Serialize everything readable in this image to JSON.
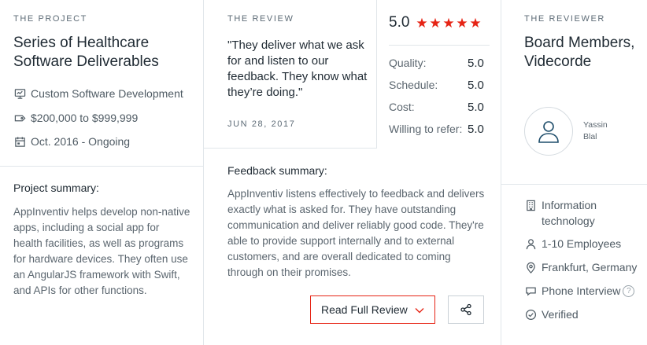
{
  "project": {
    "eyebrow": "THE PROJECT",
    "title": "Series of Healthcare Software Deliverables",
    "service": "Custom Software Development",
    "budget": "$200,000 to $999,999",
    "timeline": "Oct. 2016 - Ongoing",
    "summary_label": "Project summary:",
    "summary": "AppInventiv helps develop non-native apps, including a social app for health facilities, as well as programs for hardware devices. They often use an AngularJS framework with Swift, and APIs for other functions.",
    "icons": {
      "service": "monitor-icon",
      "budget": "tag-icon",
      "timeline": "calendar-icon"
    }
  },
  "review": {
    "eyebrow": "THE REVIEW",
    "quote": "\"They deliver what we ask for and listen to our feedback. They know what they’re doing.\"",
    "date": "JUN 28, 2017",
    "overall": "5.0",
    "stars": 5,
    "star_color": "#e62415",
    "scores": [
      {
        "label": "Quality:",
        "value": "5.0"
      },
      {
        "label": "Schedule:",
        "value": "5.0"
      },
      {
        "label": "Cost:",
        "value": "5.0"
      },
      {
        "label": "Willing to refer:",
        "value": "5.0"
      }
    ],
    "feedback_label": "Feedback summary:",
    "feedback": "AppInventiv listens effectively to feedback and delivers exactly what is asked for. They have outstanding communication and deliver reliably good code. They're able to provide support internally and to external customers, and are overall dedicated to coming through on their promises.",
    "read_button": "Read Full Review",
    "read_button_icon": "chevron-down-icon",
    "share_icon": "share-icon"
  },
  "reviewer": {
    "eyebrow": "THE REVIEWER",
    "title": "Board Members, Videcorde",
    "name_line1": "Yassin",
    "name_line2": "Blal",
    "avatar_icon": "user-icon",
    "industry": "Information technology",
    "size": "1-10 Employees",
    "location": "Frankfurt, Germany",
    "interview": "Phone Interview",
    "interview_help": "?",
    "status": "Verified",
    "icons": {
      "industry": "building-icon",
      "size": "person-icon",
      "location": "location-pin-icon",
      "interview": "speech-bubble-icon",
      "status": "check-circle-icon"
    }
  },
  "colors": {
    "accent": "#e62415",
    "border": "#e1e6ea",
    "text": "#1f2a33",
    "muted": "#5b666f"
  }
}
